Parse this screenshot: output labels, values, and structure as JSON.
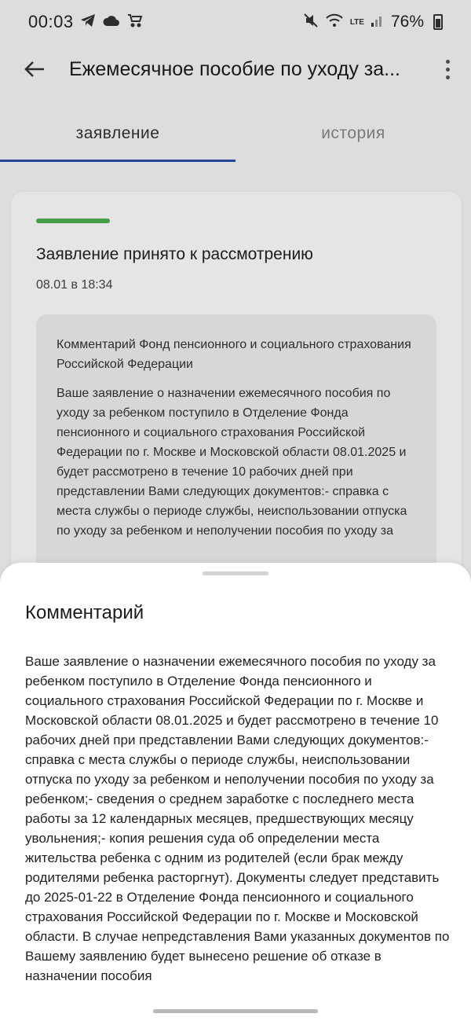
{
  "status_bar": {
    "time": "00:03",
    "battery": "76%",
    "network": "LTE"
  },
  "app_bar": {
    "title": "Ежемесячное пособие по уходу за..."
  },
  "tabs": [
    {
      "label": "заявление",
      "active": true
    },
    {
      "label": "история",
      "active": false
    }
  ],
  "card": {
    "status_color": "#4caf50",
    "title": "Заявление принято к рассмотрению",
    "date": "08.01 в 18:34",
    "comment_title": "Комментарий Фонд пенсионного и социального страхования Российской Федерации",
    "comment_text": "Ваше заявление о назначении ежемесячного пособия по уходу за ребенком поступило в Отделение Фонда пенсионного и социального страхования Российской Федерации по г. Москве и Московской области 08.01.2025 и будет рассмотрено в течение 10 рабочих дней при представлении Вами следующих документов:- справка с места службы о периоде службы, неиспользовании отпуска по уходу за ребенком и неполучении пособия по уходу за"
  },
  "sheet": {
    "title": "Комментарий",
    "text": "Ваше заявление о назначении ежемесячного пособия по уходу за ребенком поступило в Отделение Фонда пенсионного и социального страхования Российской Федерации по г. Москве и Московской области 08.01.2025 и будет рассмотрено в течение 10 рабочих дней при представлении Вами следующих документов:- справка с места службы о периоде службы, неиспользовании отпуска по уходу за ребенком и неполучении пособия по уходу за ребенком;- сведения о среднем заработке с последнего места работы за 12 календарных месяцев, предшествующих месяцу увольнения;- копия решения суда об определении места жительства ребенка с одним из родителей (если брак между родителями ребенка расторгнут). Документы следует представить до 2025-01-22 в Отделение Фонда пенсионного и социального страхования Российской Федерации по г. Москве и Московской области. В случае непредставления Вами указанных документов по Вашему заявлению будет вынесено решение об отказе в назначении пособия"
  }
}
